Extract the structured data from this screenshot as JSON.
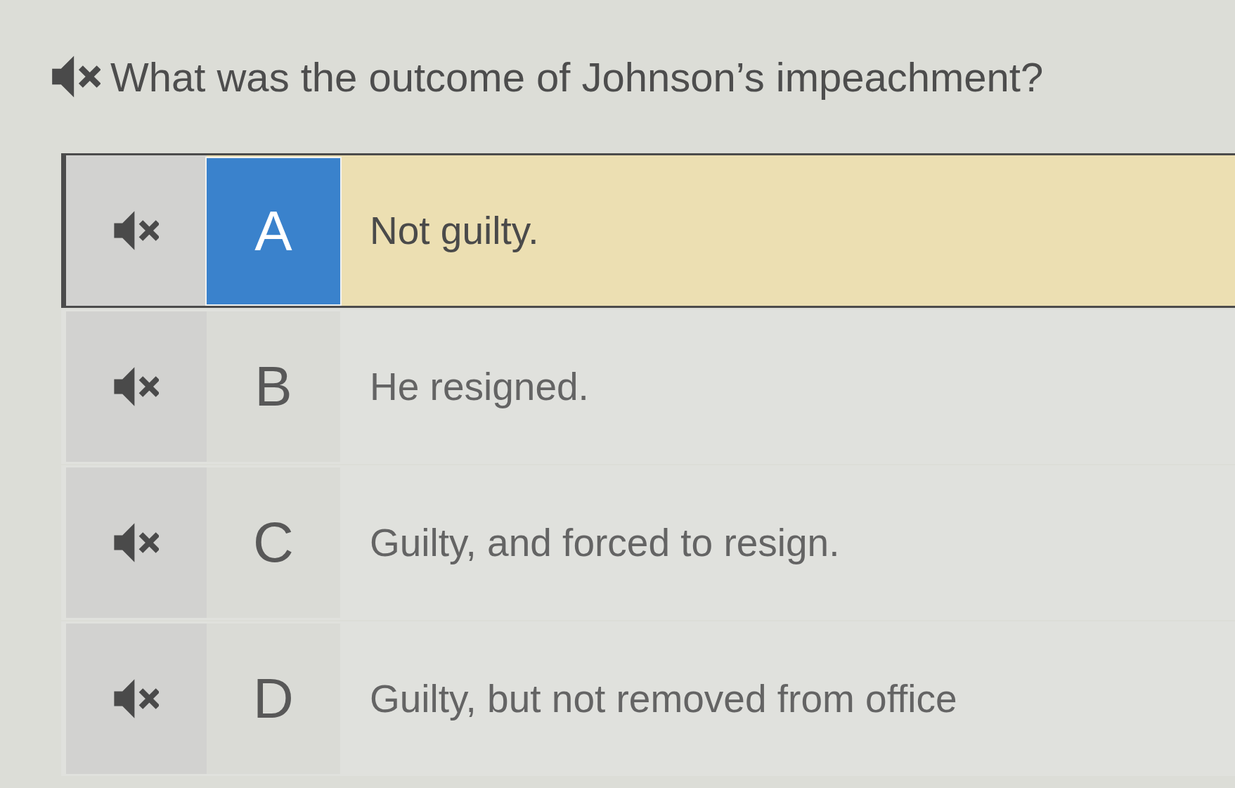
{
  "question": {
    "text": "What was the outcome of Johnson’s impeachment?"
  },
  "answers": [
    {
      "letter": "A",
      "text": "Not guilty.",
      "selected": true
    },
    {
      "letter": "B",
      "text": "He resigned.",
      "selected": false
    },
    {
      "letter": "C",
      "text": "Guilty, and forced to resign.",
      "selected": false
    },
    {
      "letter": "D",
      "text": "Guilty, but not removed from office",
      "selected": false
    }
  ]
}
